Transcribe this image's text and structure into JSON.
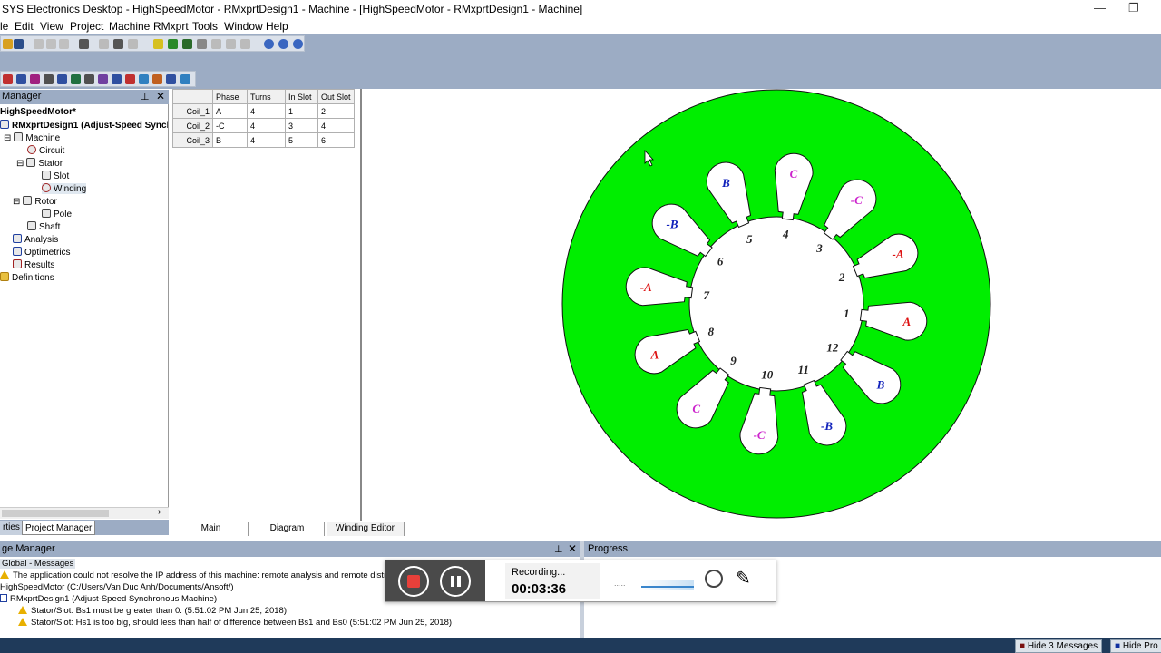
{
  "window": {
    "title": "SYS Electronics Desktop - HighSpeedMotor - RMxprtDesign1 - Machine - [HighSpeedMotor - RMxprtDesign1 - Machine]"
  },
  "menu": [
    "le",
    "Edit",
    "View",
    "Project",
    "Machine",
    "RMxprt",
    "Tools",
    "Window",
    "Help"
  ],
  "project_manager": {
    "header": "Manager",
    "tree": [
      {
        "label": "HighSpeedMotor*"
      },
      {
        "label": "RMxprtDesign1 (Adjust-Speed Synchronous Machine)"
      },
      {
        "label": "Machine"
      },
      {
        "label": "Circuit"
      },
      {
        "label": "Stator"
      },
      {
        "label": "Slot"
      },
      {
        "label": "Winding"
      },
      {
        "label": "Rotor"
      },
      {
        "label": "Pole"
      },
      {
        "label": "Shaft"
      },
      {
        "label": "Analysis"
      },
      {
        "label": "Optimetrics"
      },
      {
        "label": "Results"
      },
      {
        "label": "Definitions"
      }
    ],
    "tabs": [
      "rties",
      "Project Manager"
    ]
  },
  "coil_table": {
    "headers": [
      "",
      "Phase",
      "Turns",
      "In Slot",
      "Out Slot"
    ],
    "rows": [
      [
        "Coil_1",
        "A",
        "4",
        "1",
        "2"
      ],
      [
        "Coil_2",
        "-C",
        "4",
        "3",
        "4"
      ],
      [
        "Coil_3",
        "B",
        "4",
        "5",
        "6"
      ]
    ]
  },
  "winding_diagram": {
    "stator_color": "#00ee00",
    "slot_numbers": [
      "1",
      "2",
      "3",
      "4",
      "5",
      "6",
      "7",
      "8",
      "9",
      "10",
      "11",
      "12"
    ],
    "phase_labels": [
      {
        "text": "A",
        "color": "#dd1111"
      },
      {
        "text": "-A",
        "color": "#dd1111"
      },
      {
        "text": "-C",
        "color": "#cc22cc"
      },
      {
        "text": "C",
        "color": "#cc22cc"
      },
      {
        "text": "B",
        "color": "#1122bb"
      },
      {
        "text": "-B",
        "color": "#1122bb"
      },
      {
        "text": "-A",
        "color": "#dd1111"
      },
      {
        "text": "A",
        "color": "#dd1111"
      },
      {
        "text": "C",
        "color": "#cc22cc"
      },
      {
        "text": "-C",
        "color": "#cc22cc"
      },
      {
        "text": "-B",
        "color": "#1122bb"
      },
      {
        "text": "B",
        "color": "#1122bb"
      }
    ]
  },
  "doc_tabs": [
    "Main",
    "Diagram",
    "Winding Editor"
  ],
  "message_manager": {
    "header": "ge Manager",
    "lines": [
      {
        "text": "Global - Messages",
        "icon": "none"
      },
      {
        "text": "The application could not resolve the IP address of this machine: remote analysis and remote distrib",
        "icon": "warning-icon"
      },
      {
        "text": "HighSpeedMotor (C:/Users/Van Duc Anh/Documents/Ansoft/)",
        "icon": "none"
      },
      {
        "text": "RMxprtDesign1 (Adjust-Speed Synchronous Machine)",
        "icon": "none"
      },
      {
        "text": "Stator/Slot: Bs1 must be greater than 0. (5:51:02 PM  Jun 25, 2018)",
        "icon": "warning-icon"
      },
      {
        "text": "Stator/Slot: Hs1 is too big, should less than half of difference between Bs1 and Bs0 (5:51:02 PM  Jun 25, 2018)",
        "icon": "warning-icon"
      }
    ]
  },
  "progress": {
    "header": "Progress"
  },
  "recorder": {
    "status": "Recording...",
    "time": "00:03:36",
    "dots": "....."
  },
  "statusbar": {
    "hide_messages": "Hide 3 Messages",
    "hide_progress": "Hide Pro"
  }
}
